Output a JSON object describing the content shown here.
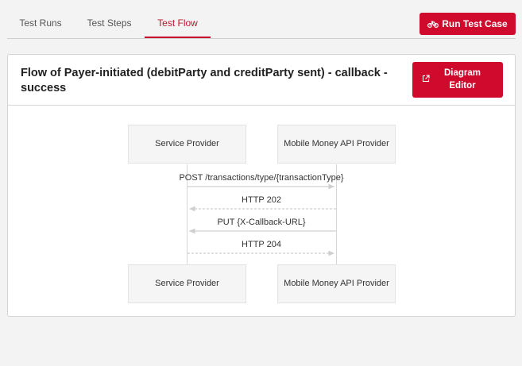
{
  "tabs": [
    {
      "label": "Test Runs",
      "active": false
    },
    {
      "label": "Test Steps",
      "active": false
    },
    {
      "label": "Test Flow",
      "active": true
    }
  ],
  "run_button": {
    "label": "Run Test Case",
    "icon": "bicycle-icon"
  },
  "panel": {
    "title": "Flow of Payer-initiated (debitParty and creditParty sent) - callback - success",
    "diagram_button": {
      "label": "Diagram Editor",
      "icon": "external-link-icon"
    }
  },
  "diagram": {
    "actors_top": [
      "Service Provider",
      "Mobile Money API Provider"
    ],
    "actors_bottom": [
      "Service Provider",
      "Mobile Money API Provider"
    ],
    "messages": [
      {
        "label": "POST /transactions/type/{transactionType}",
        "direction": "right",
        "style": "solid"
      },
      {
        "label": "HTTP 202",
        "direction": "left",
        "style": "dashed"
      },
      {
        "label": "PUT {X-Callback-URL}",
        "direction": "left",
        "style": "solid"
      },
      {
        "label": "HTTP 204",
        "direction": "right",
        "style": "dashed"
      }
    ]
  },
  "colors": {
    "accent": "#cf0a2c",
    "arrow": "#cfcfcf"
  }
}
